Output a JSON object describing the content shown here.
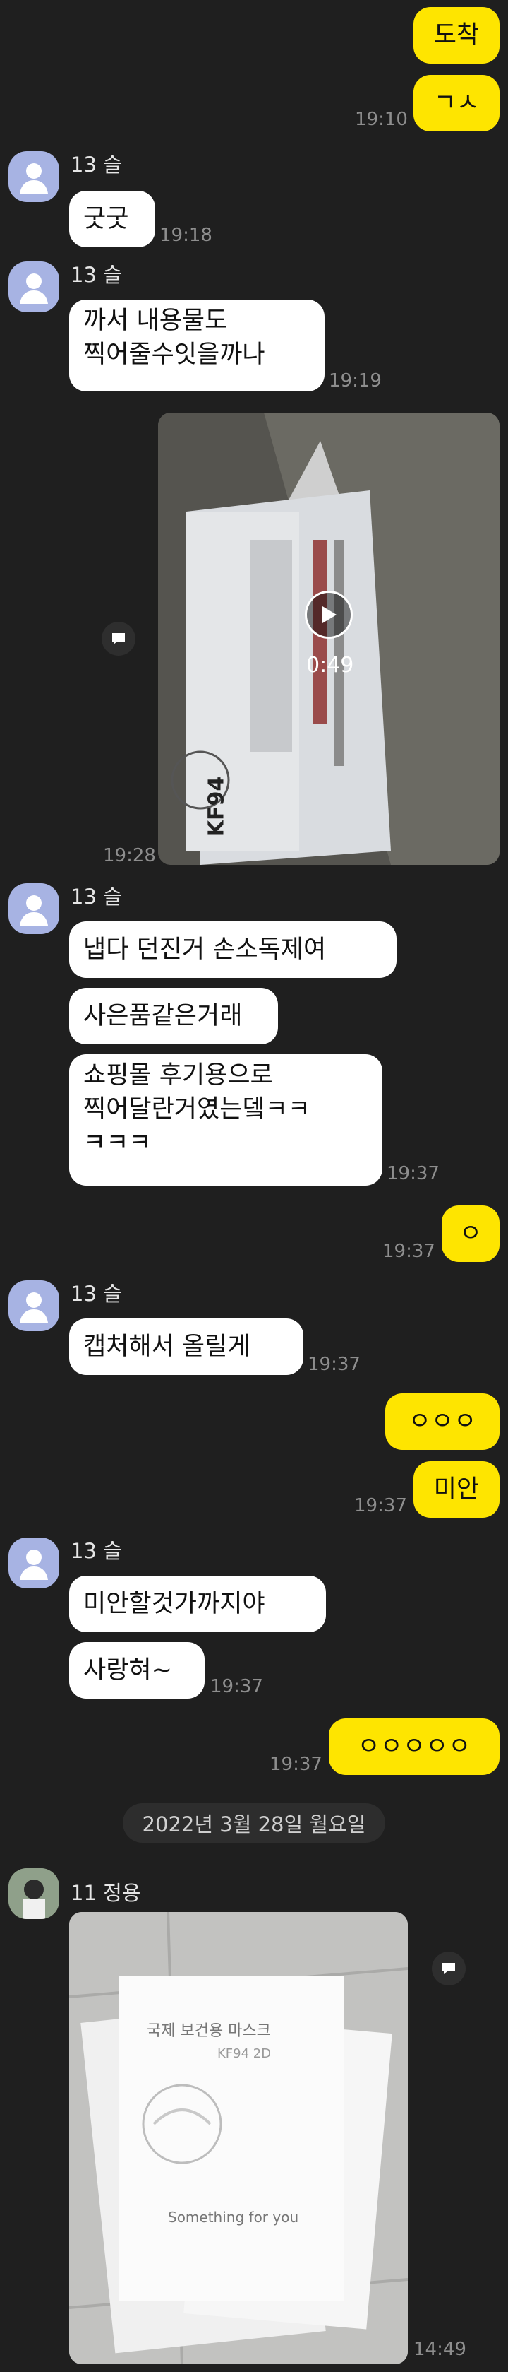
{
  "messages": {
    "m1": "도착",
    "m2": "ㄱㅅ",
    "t1": "19:10",
    "m3": "굿굿",
    "t2": "19:18",
    "m4": "까서 내용물도\n찍어줄수잇을까나",
    "t3": "19:19",
    "video_duration": "0:49",
    "video_label_1": "KF94",
    "t4": "19:28",
    "m5": "냅다 던진거 손소독제여",
    "m6": "사은품같은거래",
    "m7": "쇼핑몰 후기용으로\n찍어달란거였는뎈ㅋㅋ\nㅋㅋㅋ",
    "t5": "19:37",
    "m8": "ㅇ",
    "t6": "19:37",
    "m9": "캡처해서 올릴게",
    "t7": "19:37",
    "m10": "ㅇㅇㅇ",
    "m11": "미안",
    "t8": "19:37",
    "m12": "미안할것가까지야",
    "m13": "사랑혀~",
    "t9": "19:37",
    "m14": "ㅇㅇㅇㅇㅇ",
    "t10": "19:37",
    "date": "2022년 3월 28일 월요일",
    "photo_text_1": "국제 보건용 마스크",
    "photo_text_2": "KF94 2D",
    "photo_text_3": "Something for you",
    "t11": "14:49"
  },
  "senders": {
    "s1": "13 슬",
    "s2": "11 정용"
  },
  "colors": {
    "background": "#1f1f1f",
    "incoming": "#ffffff",
    "outgoing": "#fee500",
    "avatar": "#a7b3e3"
  }
}
